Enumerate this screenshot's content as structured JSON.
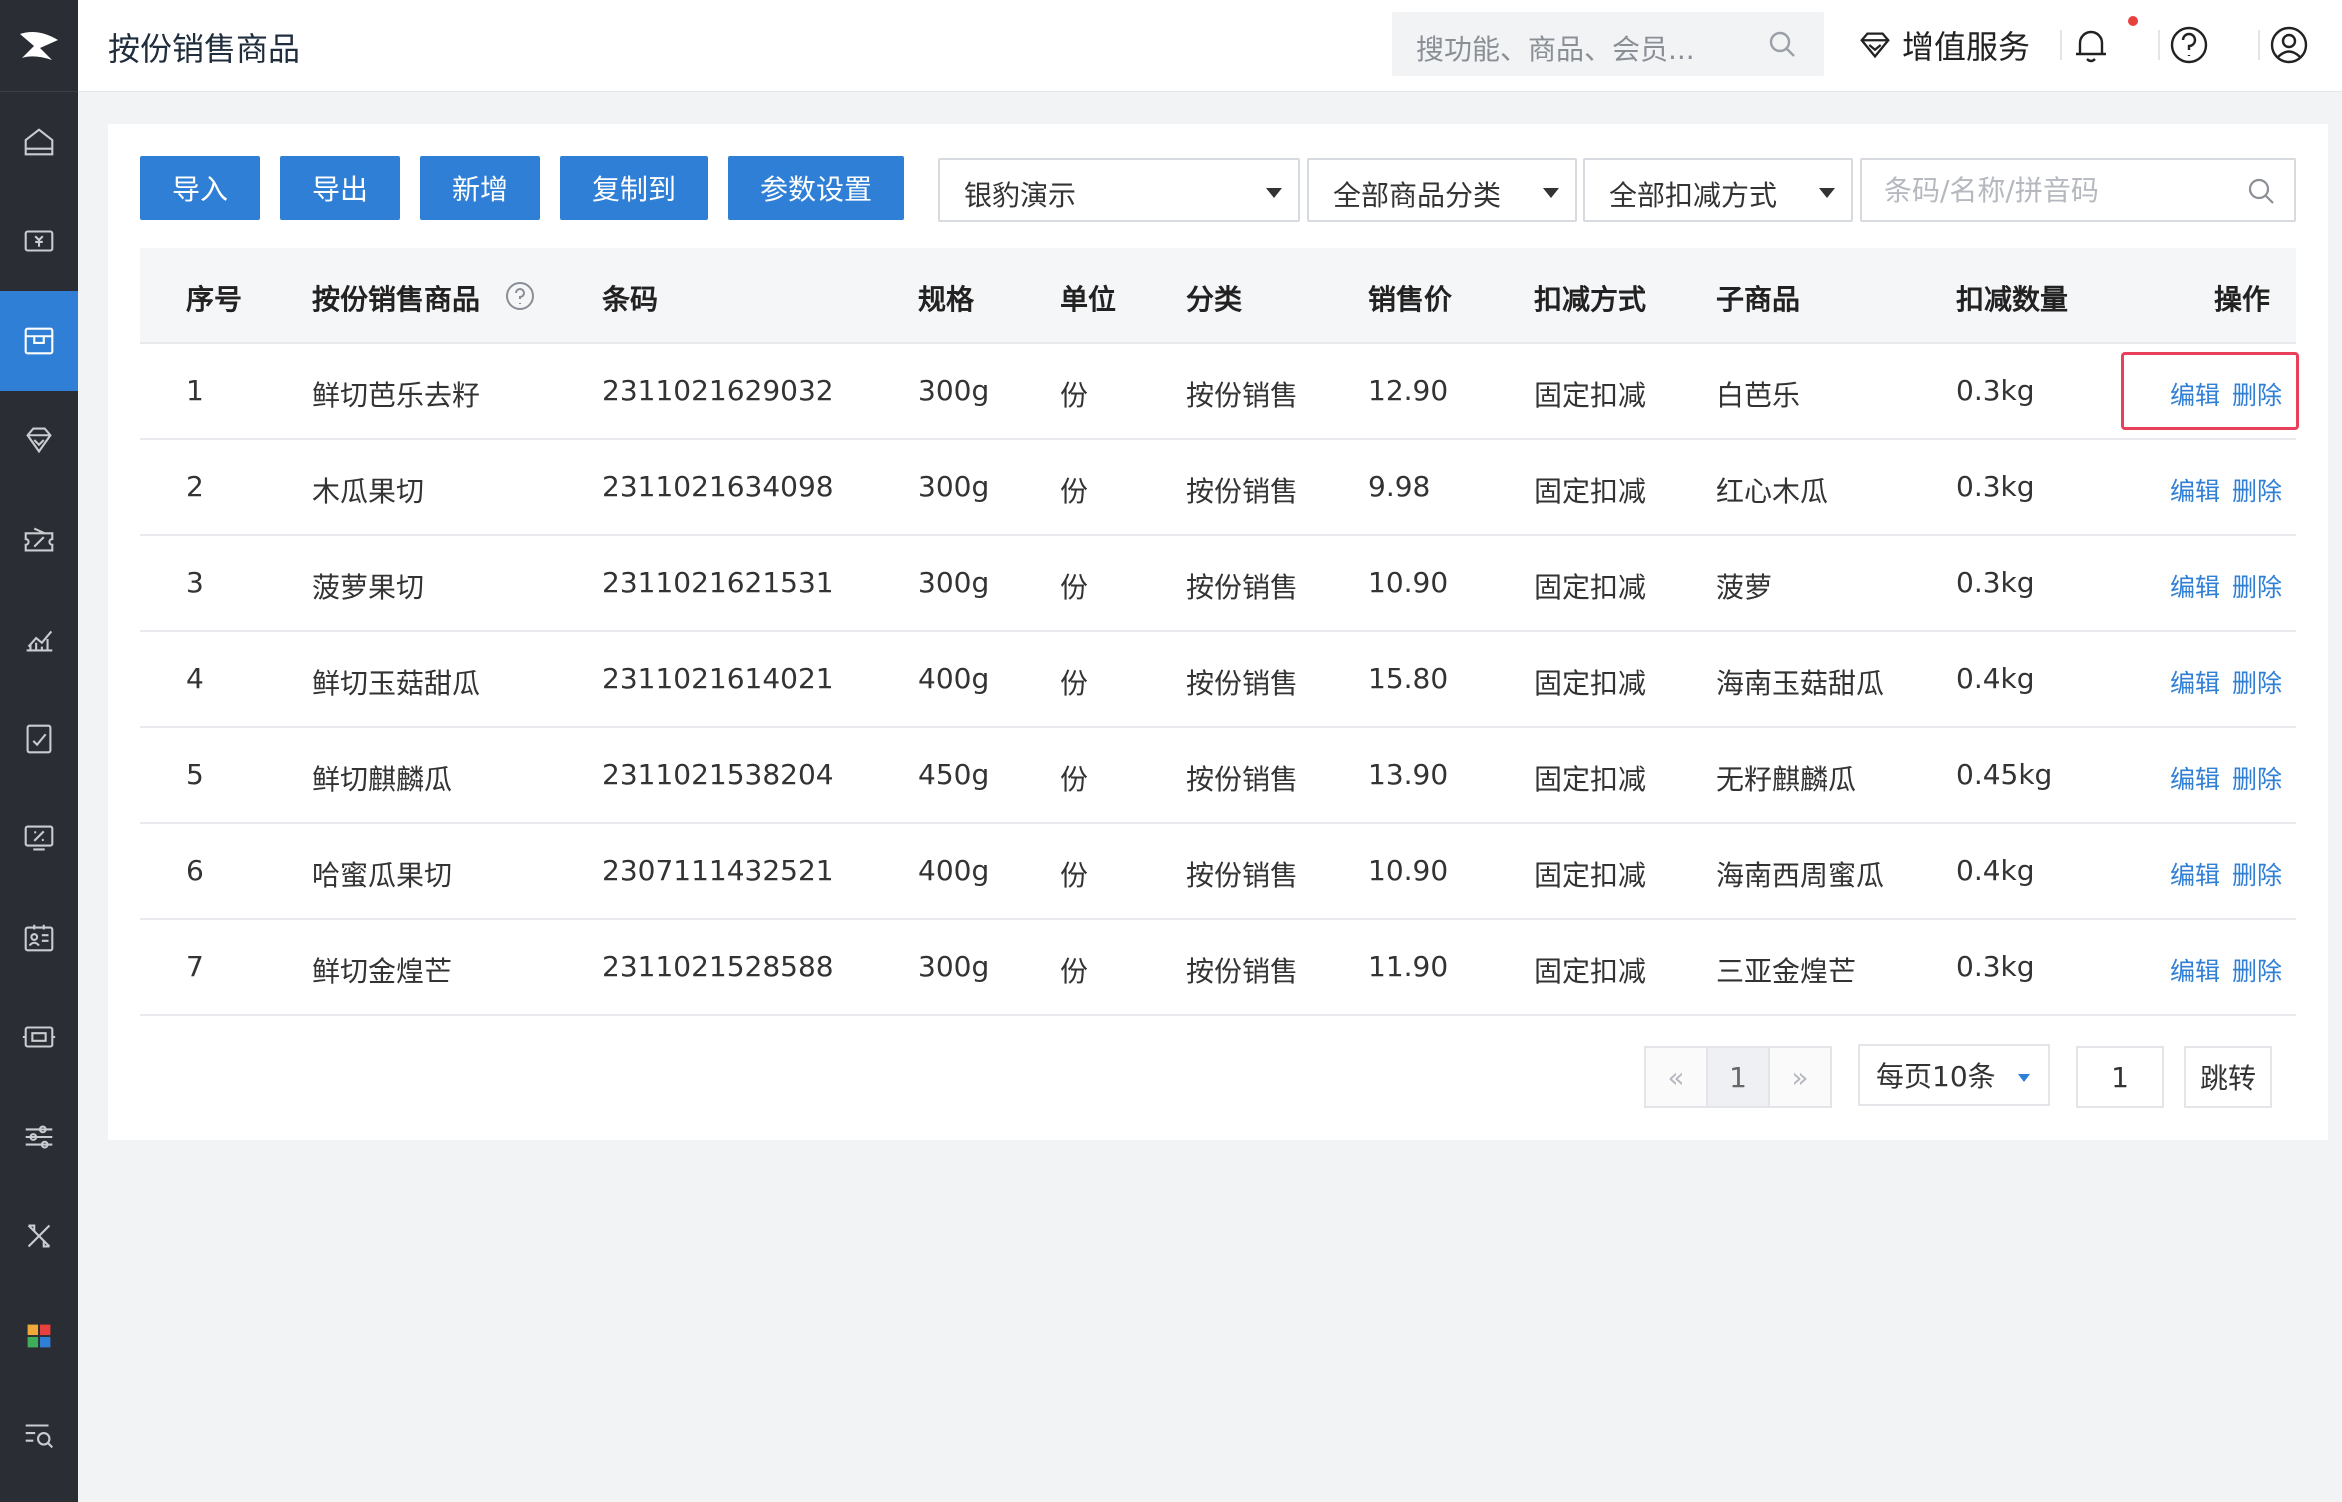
{
  "header": {
    "title": "按份销售商品",
    "search_placeholder": "搜功能、商品、会员...",
    "value_added_label": "增值服务"
  },
  "toolbar": {
    "buttons": [
      "导入",
      "导出",
      "新增",
      "复制到",
      "参数设置"
    ],
    "store_select": "银豹演示",
    "category_select": "全部商品分类",
    "deduct_select": "全部扣减方式",
    "search_placeholder": "条码/名称/拼音码"
  },
  "table": {
    "columns": [
      "序号",
      "按份销售商品",
      "条码",
      "规格",
      "单位",
      "分类",
      "销售价",
      "扣减方式",
      "子商品",
      "扣减数量",
      "操作"
    ],
    "edit_label": "编辑",
    "delete_label": "删除",
    "rows": [
      [
        "1",
        "鲜切芭乐去籽",
        "2311021629032",
        "300g",
        "份",
        "按份销售",
        "12.90",
        "固定扣减",
        "白芭乐",
        "0.3kg"
      ],
      [
        "2",
        "木瓜果切",
        "2311021634098",
        "300g",
        "份",
        "按份销售",
        "9.98",
        "固定扣减",
        "红心木瓜",
        "0.3kg"
      ],
      [
        "3",
        "菠萝果切",
        "2311021621531",
        "300g",
        "份",
        "按份销售",
        "10.90",
        "固定扣减",
        "菠萝",
        "0.3kg"
      ],
      [
        "4",
        "鲜切玉菇甜瓜",
        "2311021614021",
        "400g",
        "份",
        "按份销售",
        "15.80",
        "固定扣减",
        "海南玉菇甜瓜",
        "0.4kg"
      ],
      [
        "5",
        "鲜切麒麟瓜",
        "2311021538204",
        "450g",
        "份",
        "按份销售",
        "13.90",
        "固定扣减",
        "无籽麒麟瓜",
        "0.45kg"
      ],
      [
        "6",
        "哈蜜瓜果切",
        "2307111432521",
        "400g",
        "份",
        "按份销售",
        "10.90",
        "固定扣减",
        "海南西周蜜瓜",
        "0.4kg"
      ],
      [
        "7",
        "鲜切金煌芒",
        "2311021528588",
        "300g",
        "份",
        "按份销售",
        "11.90",
        "固定扣减",
        "三亚金煌芒",
        "0.3kg"
      ]
    ]
  },
  "pagination": {
    "prev": "«",
    "current": "1",
    "next": "»",
    "page_size": "每页10条",
    "jump_value": "1",
    "jump_label": "跳转"
  },
  "colors": {
    "primary": "#2f7fd6",
    "sidebar": "#2a2d33",
    "highlight": "#e8405a"
  }
}
